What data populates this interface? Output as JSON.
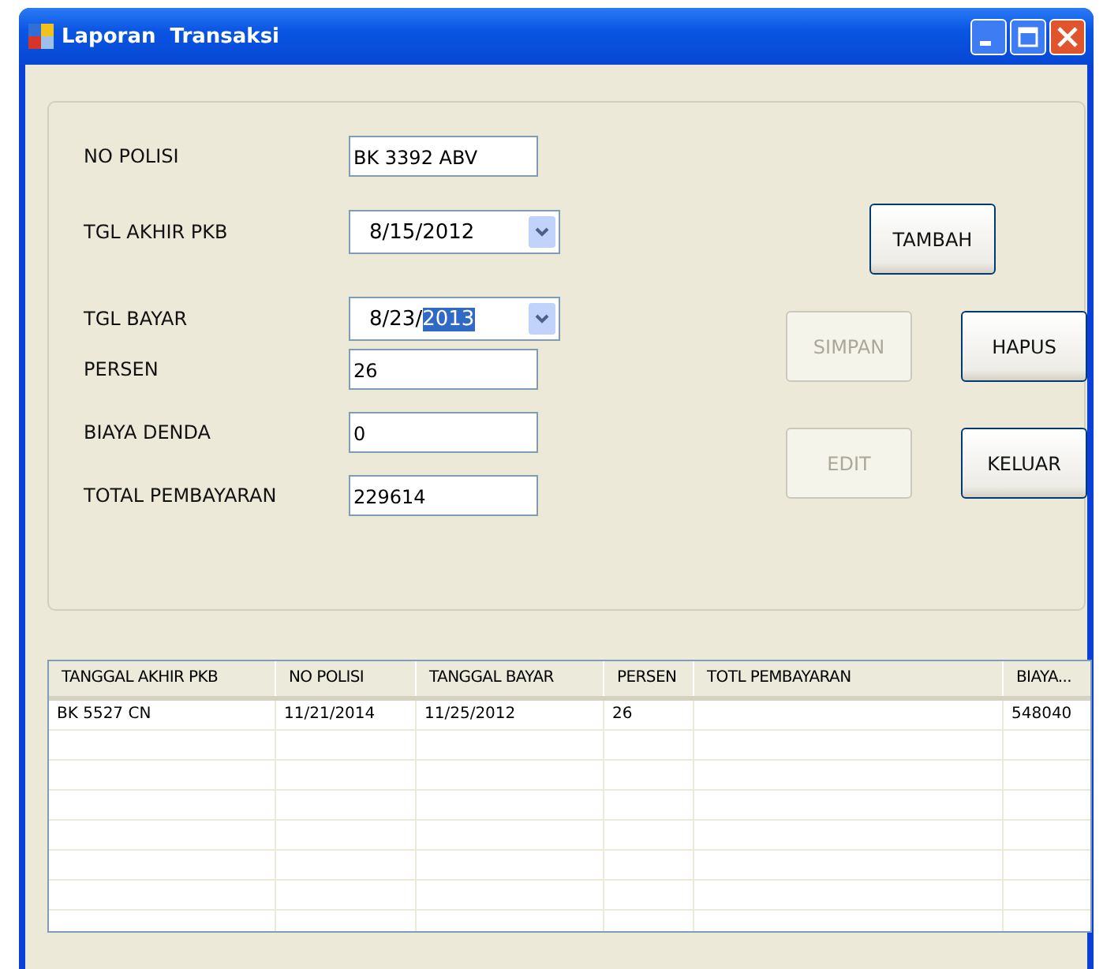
{
  "window": {
    "title": "Laporan  Transaksi"
  },
  "fields": [
    {
      "kind": "text",
      "label": "NO POLISI",
      "value": "BK 3392 ABV"
    },
    {
      "kind": "date",
      "label": "TGL AKHIR PKB",
      "parts": [
        {
          "text": "8/15/2012",
          "selected": false
        }
      ]
    },
    {
      "kind": "date",
      "label": "TGL BAYAR",
      "parts": [
        {
          "text": "8/23/",
          "selected": false
        },
        {
          "text": "2013",
          "selected": true
        }
      ]
    },
    {
      "kind": "text",
      "label": "PERSEN",
      "value": "26"
    },
    {
      "kind": "text",
      "label": "BIAYA DENDA",
      "value": "0"
    },
    {
      "kind": "text",
      "label": "TOTAL PEMBAYARAN",
      "value": "229614"
    }
  ],
  "buttons": [
    {
      "label": "TAMBAH",
      "disabled": false
    },
    {
      "label": "SIMPAN",
      "disabled": true
    },
    {
      "label": "HAPUS",
      "disabled": false
    },
    {
      "label": "EDIT",
      "disabled": true
    },
    {
      "label": "KELUAR",
      "disabled": false
    }
  ],
  "table": {
    "columns": [
      "TANGGAL AKHIR PKB",
      "NO POLISI",
      "TANGGAL BAYAR",
      "PERSEN",
      "TOTL PEMBAYARAN",
      "BIAYA..."
    ],
    "rows": [
      [
        "BK 5527 CN",
        "11/21/2014",
        "11/25/2012",
        "26",
        "",
        "548040"
      ]
    ]
  }
}
